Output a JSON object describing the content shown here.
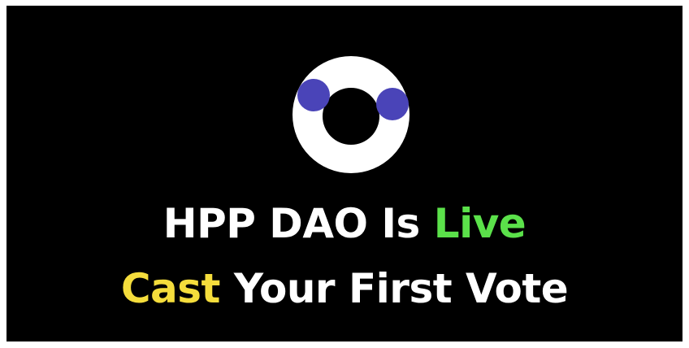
{
  "logo": {
    "icon": "ring-with-two-dots-icon",
    "ring_color": "#ffffff",
    "dot_color": "#4a44b8",
    "background": "#000000"
  },
  "headline": {
    "line1": {
      "text_a": "HPP DAO Is ",
      "text_b": "Live"
    },
    "line2": {
      "text_a": "Cast",
      "text_b": " Your First Vote"
    }
  },
  "colors": {
    "white": "#ffffff",
    "green": "#5be14a",
    "yellow": "#f5dd3c"
  }
}
